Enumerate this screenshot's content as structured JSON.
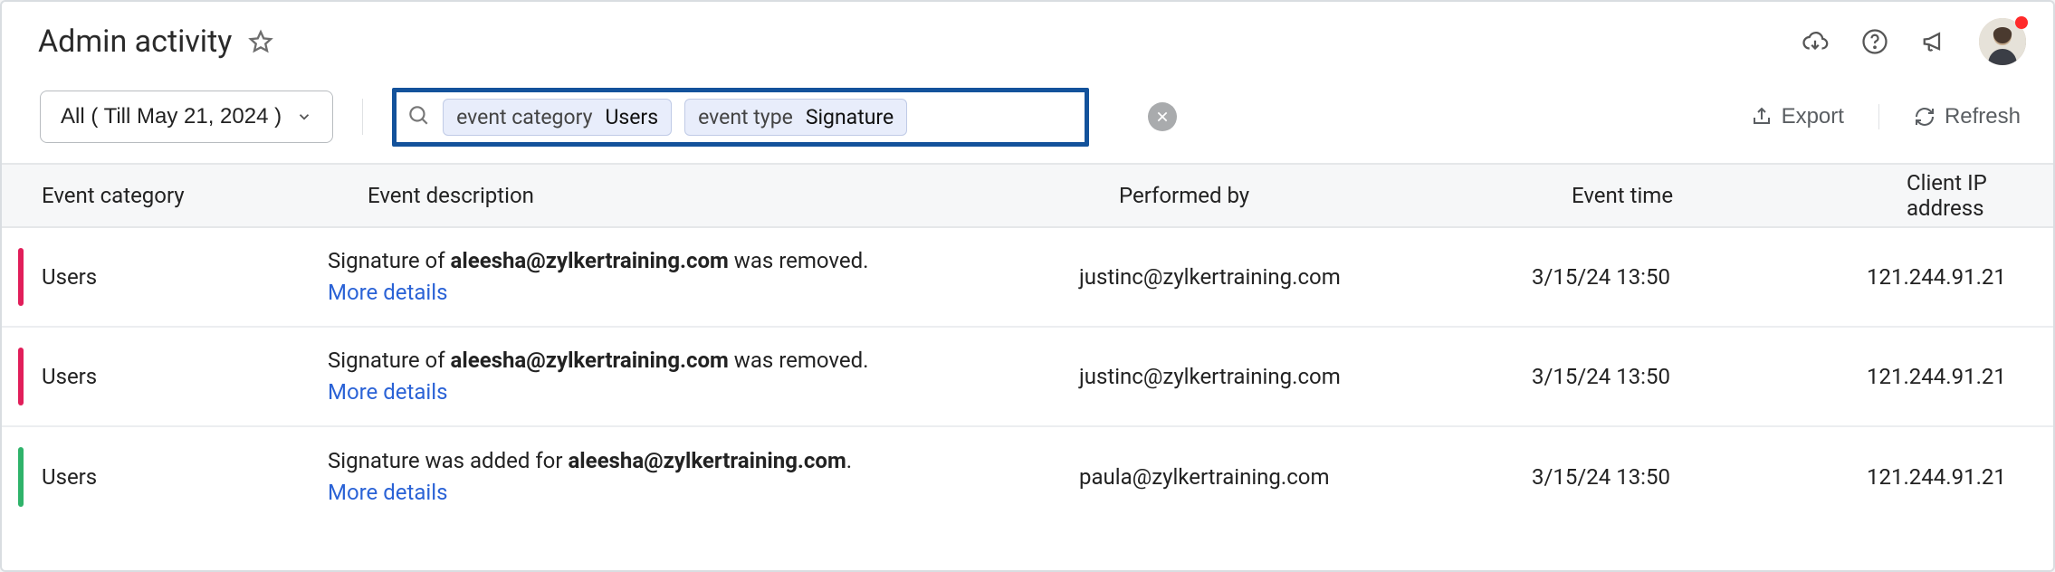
{
  "header": {
    "title": "Admin activity"
  },
  "toolbar": {
    "filter_dropdown": "All ( Till May 21, 2024 )",
    "search_chips": [
      {
        "label": "event category",
        "value": "Users"
      },
      {
        "label": "event type",
        "value": "Signature"
      }
    ],
    "export_label": "Export",
    "refresh_label": "Refresh"
  },
  "table": {
    "columns": {
      "category": "Event category",
      "description": "Event description",
      "performed_by": "Performed by",
      "event_time": "Event time",
      "client_ip": "Client IP address"
    },
    "rows": [
      {
        "marker": "red",
        "category": "Users",
        "desc_prefix": "Signature of ",
        "desc_bold": "aleesha@zylkertraining.com",
        "desc_suffix": " was removed. ",
        "more": "More details",
        "performed_by": "justinc@zylkertraining.com",
        "event_time": "3/15/24 13:50",
        "client_ip": "121.244.91.21"
      },
      {
        "marker": "red",
        "category": "Users",
        "desc_prefix": "Signature of ",
        "desc_bold": "aleesha@zylkertraining.com",
        "desc_suffix": " was removed. ",
        "more": "More details",
        "performed_by": "justinc@zylkertraining.com",
        "event_time": "3/15/24 13:50",
        "client_ip": "121.244.91.21"
      },
      {
        "marker": "green",
        "category": "Users",
        "desc_prefix": "Signature was added for ",
        "desc_bold": "aleesha@zylkertraining.com",
        "desc_suffix": ". ",
        "more": "More details",
        "performed_by": "paula@zylkertraining.com",
        "event_time": "3/15/24 13:50",
        "client_ip": "121.244.91.21"
      }
    ]
  }
}
